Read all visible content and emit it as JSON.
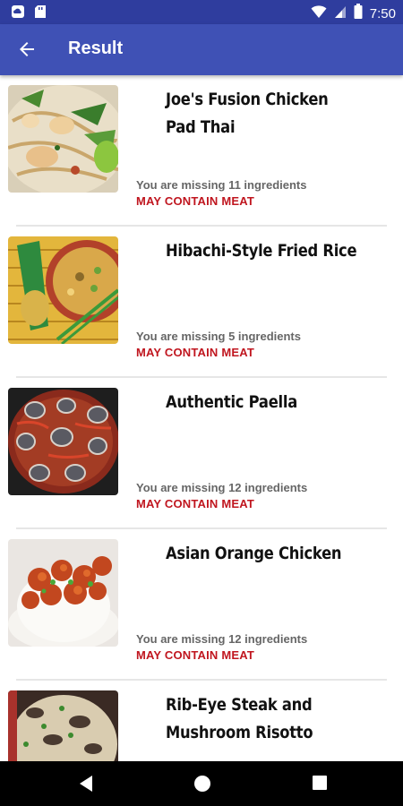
{
  "status_bar": {
    "time": "7:50",
    "left_icons": [
      "cloud-icon",
      "sd-card-icon"
    ],
    "right_icons": [
      "wifi-icon",
      "signal-icon",
      "battery-icon"
    ]
  },
  "app_bar": {
    "title": "Result",
    "back_icon": "arrow-back-icon",
    "color": "#3f51b5"
  },
  "recipes": [
    {
      "title": "Joe's Fusion Chicken Pad Thai",
      "missing": "You are missing 11 ingredients",
      "warning": "MAY CONTAIN MEAT"
    },
    {
      "title": "Hibachi-Style Fried Rice",
      "missing": "You are missing 5 ingredients",
      "warning": "MAY CONTAIN MEAT"
    },
    {
      "title": "Authentic Paella",
      "missing": "You are missing 12 ingredients",
      "warning": "MAY CONTAIN MEAT"
    },
    {
      "title": "Asian Orange Chicken",
      "missing": "You are missing 12 ingredients",
      "warning": "MAY CONTAIN MEAT"
    },
    {
      "title": "Rib-Eye Steak and Mushroom Risotto",
      "missing": "",
      "warning": ""
    }
  ],
  "colors": {
    "status_bar": "#2f3d9e",
    "warning": "#c0161f",
    "missing_text": "#666666"
  },
  "nav_bar": {
    "icons": [
      "back-triangle-icon",
      "home-circle-icon",
      "recents-square-icon"
    ]
  }
}
